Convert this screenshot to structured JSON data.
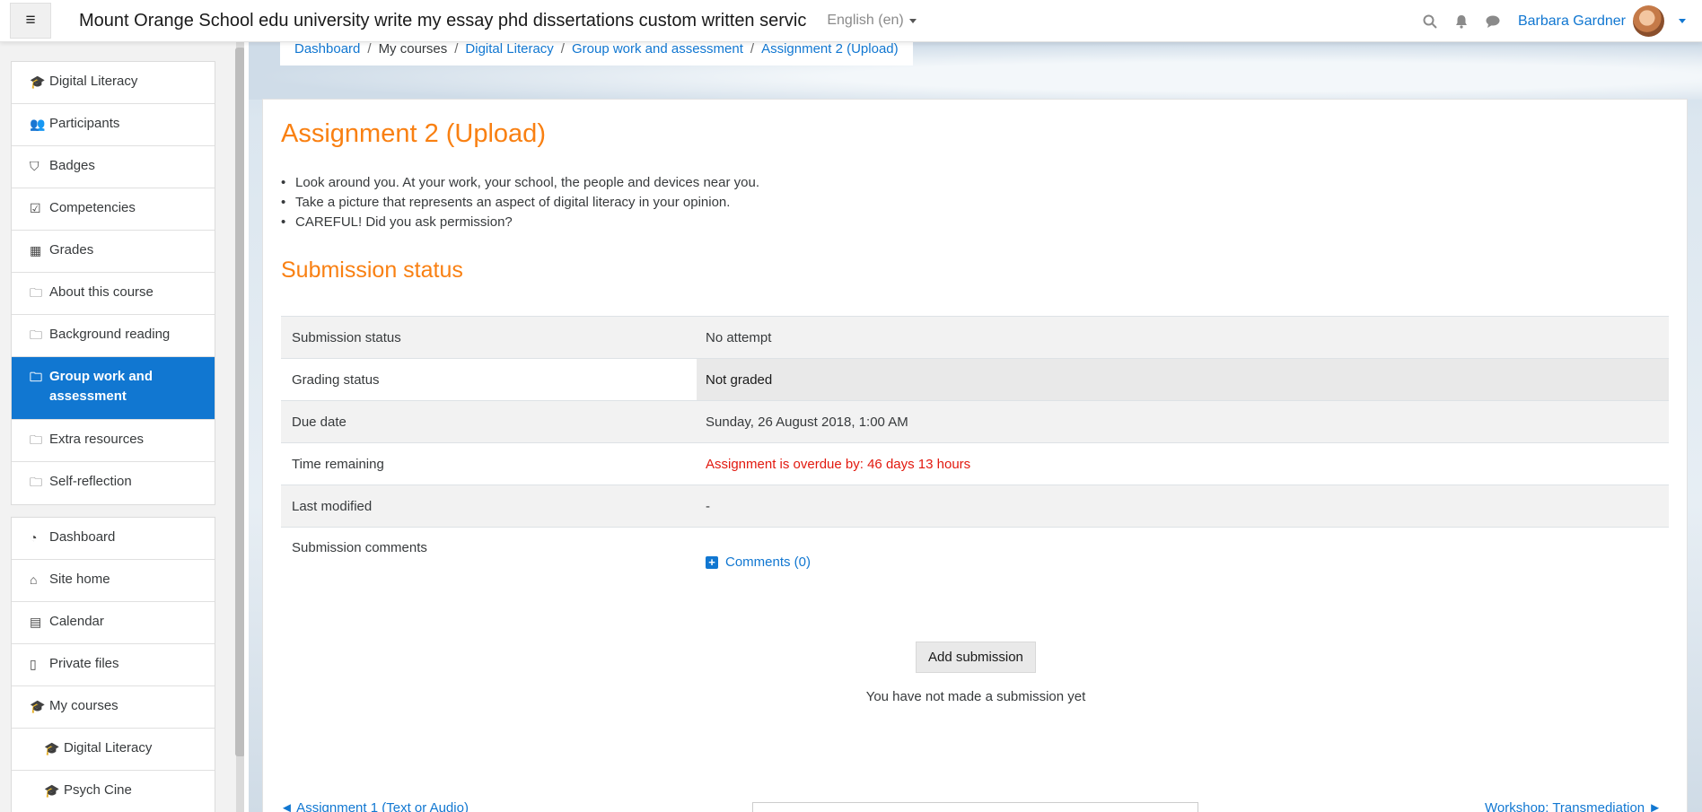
{
  "navbar": {
    "site_title": "Mount Orange School edu university write my essay phd dissertations custom written servic",
    "language": "English (en)",
    "user_name": "Barbara Gardner"
  },
  "course_nav": [
    {
      "icon": "graduation-cap-icon",
      "glyph": "🎓",
      "label": "Digital Literacy"
    },
    {
      "icon": "users-icon",
      "glyph": "👥",
      "label": "Participants"
    },
    {
      "icon": "shield-icon",
      "glyph": "⛉",
      "label": "Badges"
    },
    {
      "icon": "check-square-icon",
      "glyph": "☑",
      "label": "Competencies"
    },
    {
      "icon": "table-icon",
      "glyph": "▦",
      "label": "Grades"
    },
    {
      "icon": "folder-icon",
      "glyph": "🗀",
      "label": "About this course"
    },
    {
      "icon": "folder-icon",
      "glyph": "🗀",
      "label": "Background reading"
    },
    {
      "icon": "folder-icon",
      "glyph": "🗀",
      "label": "Group work and assessment"
    },
    {
      "icon": "folder-icon",
      "glyph": "🗀",
      "label": "Extra resources"
    },
    {
      "icon": "folder-icon",
      "glyph": "🗀",
      "label": "Self-reflection"
    }
  ],
  "site_nav": [
    {
      "icon": "dashboard-icon",
      "glyph": "◔",
      "label": "Dashboard"
    },
    {
      "icon": "home-icon",
      "glyph": "⌂",
      "label": "Site home"
    },
    {
      "icon": "calendar-icon",
      "glyph": "▤",
      "label": "Calendar"
    },
    {
      "icon": "file-icon",
      "glyph": "▯",
      "label": "Private files"
    },
    {
      "icon": "graduation-cap-icon",
      "glyph": "🎓",
      "label": "My courses"
    },
    {
      "icon": "graduation-cap-icon",
      "glyph": "🎓",
      "label": "Digital Literacy"
    },
    {
      "icon": "graduation-cap-icon",
      "glyph": "🎓",
      "label": "Psych Cine"
    }
  ],
  "breadcrumb": {
    "dashboard": "Dashboard",
    "my_courses": "My courses",
    "course": "Digital Literacy",
    "section": "Group work and assessment",
    "current": "Assignment 2 (Upload)"
  },
  "page": {
    "title": "Assignment 2 (Upload)",
    "intro": [
      "Look around you. At your work, your school, the people and devices near you.",
      "Take a picture that represents an aspect of digital literacy  in your opinion.",
      "CAREFUL! Did you ask permission?"
    ],
    "section_heading": "Submission status"
  },
  "submission": {
    "rows": [
      {
        "label": "Submission status",
        "value": "No attempt"
      },
      {
        "label": "Grading status",
        "value": "Not graded"
      },
      {
        "label": "Due date",
        "value": "Sunday, 26 August 2018, 1:00 AM"
      },
      {
        "label": "Time remaining",
        "value": "Assignment is overdue by: 46 days 13 hours"
      },
      {
        "label": "Last modified",
        "value": "-"
      },
      {
        "label": "Submission comments",
        "value": "Comments (0)"
      }
    ],
    "add_button": "Add submission",
    "note": "You have not made a submission yet"
  },
  "footer_nav": {
    "prev": "◄ Assignment 1 (Text or Audio)",
    "next": "Workshop: Transmediation ►"
  },
  "colors": {
    "brand_orange": "#f98012",
    "link_blue": "#1177d1",
    "overdue_red": "#e2190f"
  }
}
